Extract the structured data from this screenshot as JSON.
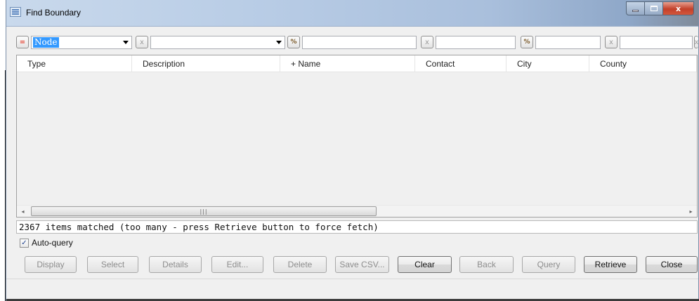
{
  "window": {
    "title": "Find Boundary"
  },
  "filters": {
    "op1": "=",
    "node_value": "Node",
    "op2": "x",
    "op3": "%",
    "op4": "x",
    "op5": "%",
    "op6": "x",
    "op7": "x"
  },
  "grid": {
    "columns": [
      "Type",
      "Description",
      "+ Name",
      "Contact",
      "City",
      "County"
    ],
    "rows": [],
    "scroll_left": "◂",
    "scroll_right": "▸",
    "scroll_thumb": "|||"
  },
  "status": {
    "message": "2367 items matched (too many - press Retrieve button to force fetch)"
  },
  "autoquery": {
    "label": "Auto-query",
    "checked": true,
    "check_glyph": "✓"
  },
  "buttons": {
    "display": "Display",
    "select": "Select",
    "details": "Details",
    "edit": "Edit...",
    "delete": "Delete",
    "save_csv": "Save CSV...",
    "clear": "Clear",
    "back": "Back",
    "query": "Query",
    "retrieve": "Retrieve",
    "close": "Close"
  },
  "icons": {
    "app": "table-icon",
    "minimize": "minimize-icon",
    "maximize": "maximize-icon",
    "close": "close-icon"
  },
  "colors": {
    "selection": "#3399ff",
    "close_button": "#c2402a",
    "titlebar": "#b9cde6"
  }
}
